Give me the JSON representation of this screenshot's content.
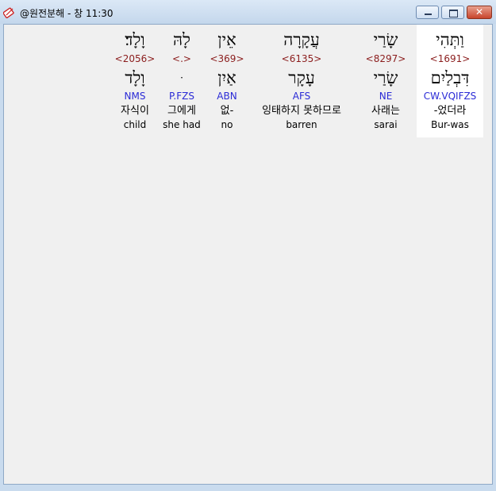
{
  "window": {
    "title": "@원전분해 - 창 11:30",
    "close_glyph": "✕"
  },
  "words": [
    {
      "hebrew": "וַתְּהִי",
      "strong": "<1691>",
      "lemma": "דִּבְלַיִם",
      "morph": "CW.VQIFZS",
      "korean": "-었더라",
      "english": "Bur-was",
      "selected": true
    },
    {
      "hebrew": "שָׂרַי",
      "strong": "<8297>",
      "lemma": "שָׂרַי",
      "morph": "NE",
      "korean": "사래는",
      "english": "sarai",
      "selected": false
    },
    {
      "hebrew": "עֲקָרָה",
      "strong": "<6135>",
      "lemma": "עָקָר",
      "morph": "AFS",
      "korean": "잉태하지 못하므로",
      "english": "barren",
      "selected": false
    },
    {
      "hebrew": "אֵין",
      "strong": "<369>",
      "lemma": "אַיִן",
      "morph": "ABN",
      "korean": "없-",
      "english": "no",
      "selected": false
    },
    {
      "hebrew": "לָהּ",
      "strong": "<.>",
      "lemma": "ּ",
      "morph": "P.FZS",
      "korean": "그에게",
      "english": "she had",
      "selected": false
    },
    {
      "hebrew": "וָלָד׃",
      "strong": "<2056>",
      "lemma": "וָלָד",
      "morph": "NMS",
      "korean": "자식이",
      "english": "child",
      "selected": false
    }
  ]
}
